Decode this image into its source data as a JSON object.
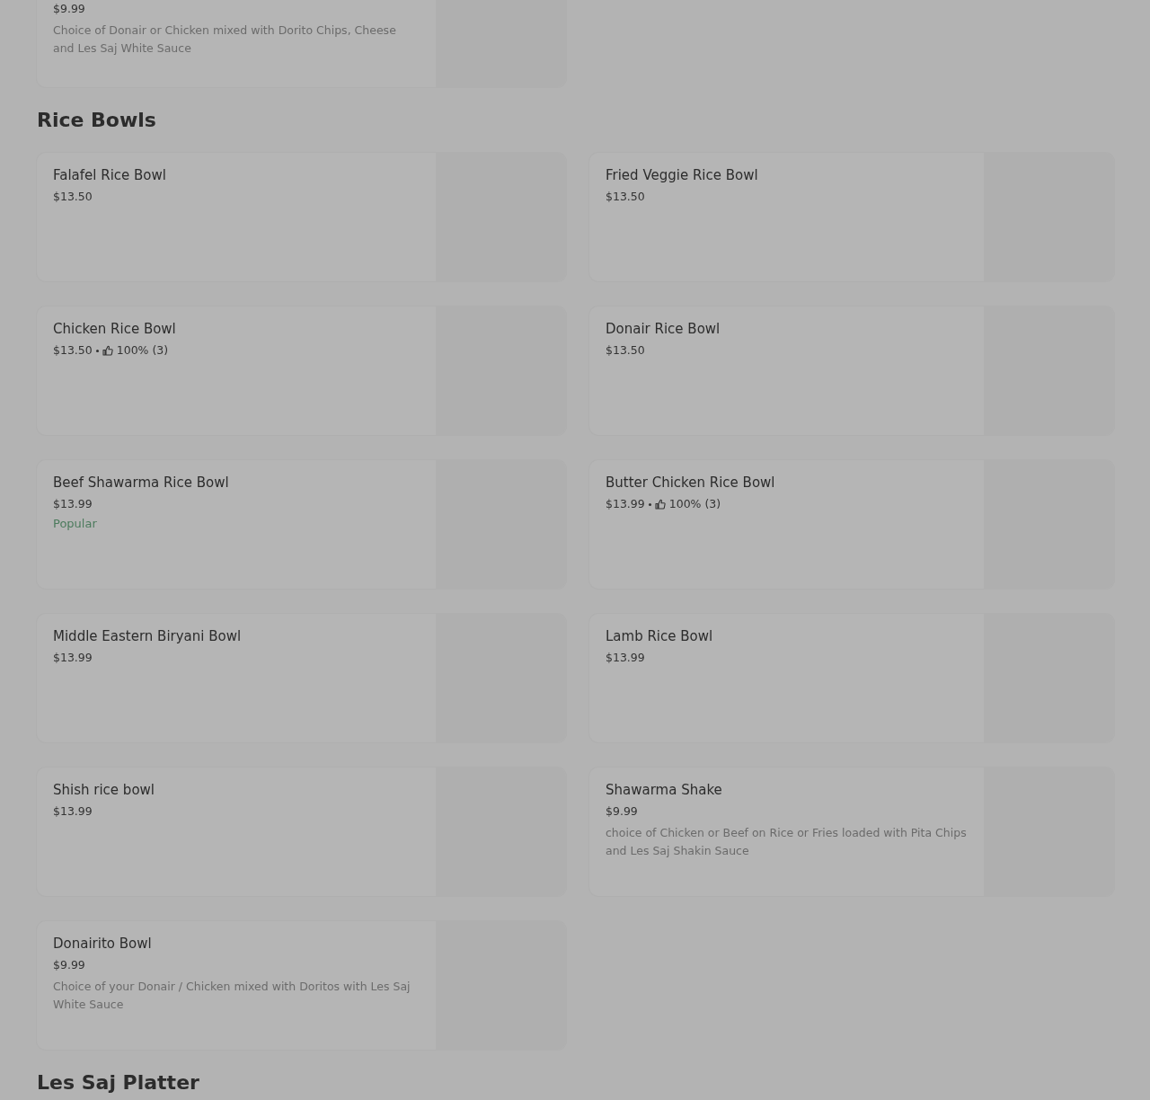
{
  "top_item": {
    "price": "$9.99",
    "description": "Choice of Donair or Chicken mixed with Dorito Chips, Cheese and Les Saj White Sauce"
  },
  "sections": [
    {
      "title": "Rice Bowls",
      "items": [
        {
          "name": "Falafel Rice Bowl",
          "price": "$13.50"
        },
        {
          "name": "Fried Veggie Rice Bowl",
          "price": "$13.50"
        },
        {
          "name": "Chicken Rice Bowl",
          "price": "$13.50",
          "rating": "100% (3)"
        },
        {
          "name": "Donair Rice Bowl",
          "price": "$13.50"
        },
        {
          "name": "Beef Shawarma Rice Bowl",
          "price": "$13.99",
          "badge": "Popular"
        },
        {
          "name": "Butter Chicken Rice Bowl",
          "price": "$13.99",
          "rating": "100% (3)"
        },
        {
          "name": "Middle Eastern Biryani Bowl",
          "price": "$13.99"
        },
        {
          "name": "Lamb Rice Bowl",
          "price": "$13.99"
        },
        {
          "name": "Shish rice bowl",
          "price": "$13.99"
        },
        {
          "name": "Shawarma Shake",
          "price": "$9.99",
          "description": "choice of Chicken or Beef on Rice or Fries loaded with Pita Chips and Les Saj Shakin Sauce"
        },
        {
          "name": "Donairito Bowl",
          "price": "$9.99",
          "description": "Choice of your Donair / Chicken mixed with Doritos with Les Saj White Sauce"
        }
      ]
    },
    {
      "title": "Les Saj Platter"
    }
  ]
}
